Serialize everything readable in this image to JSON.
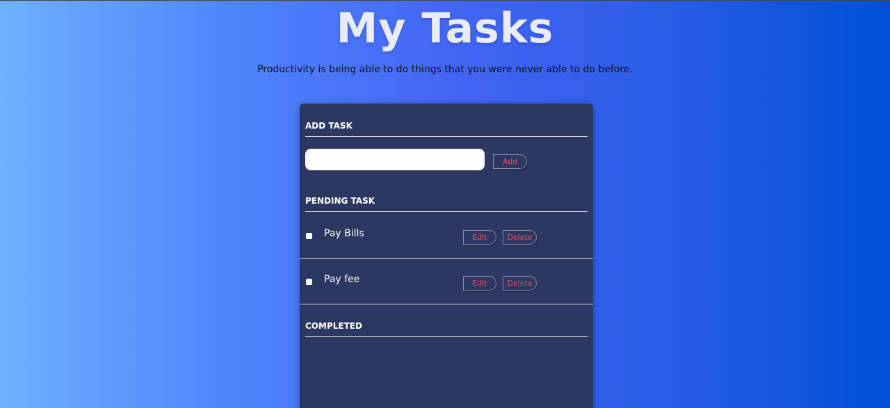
{
  "header": {
    "title": "My Tasks",
    "quote": "Productivity is being able to do things that you were never able to do before."
  },
  "add_section": {
    "heading": "ADD TASK",
    "input_value": "",
    "add_label": "Add"
  },
  "pending_section": {
    "heading": "PENDING TASK",
    "tasks": [
      {
        "label": "Pay Bills",
        "checked": false,
        "edit_label": "Edit",
        "delete_label": "Delete"
      },
      {
        "label": "Pay fee",
        "checked": false,
        "edit_label": "Edit",
        "delete_label": "Delete"
      }
    ]
  },
  "completed_section": {
    "heading": "COMPLETED",
    "tasks": []
  },
  "colors": {
    "card_background": "#2d3862",
    "button_text": "#f04a5e"
  }
}
